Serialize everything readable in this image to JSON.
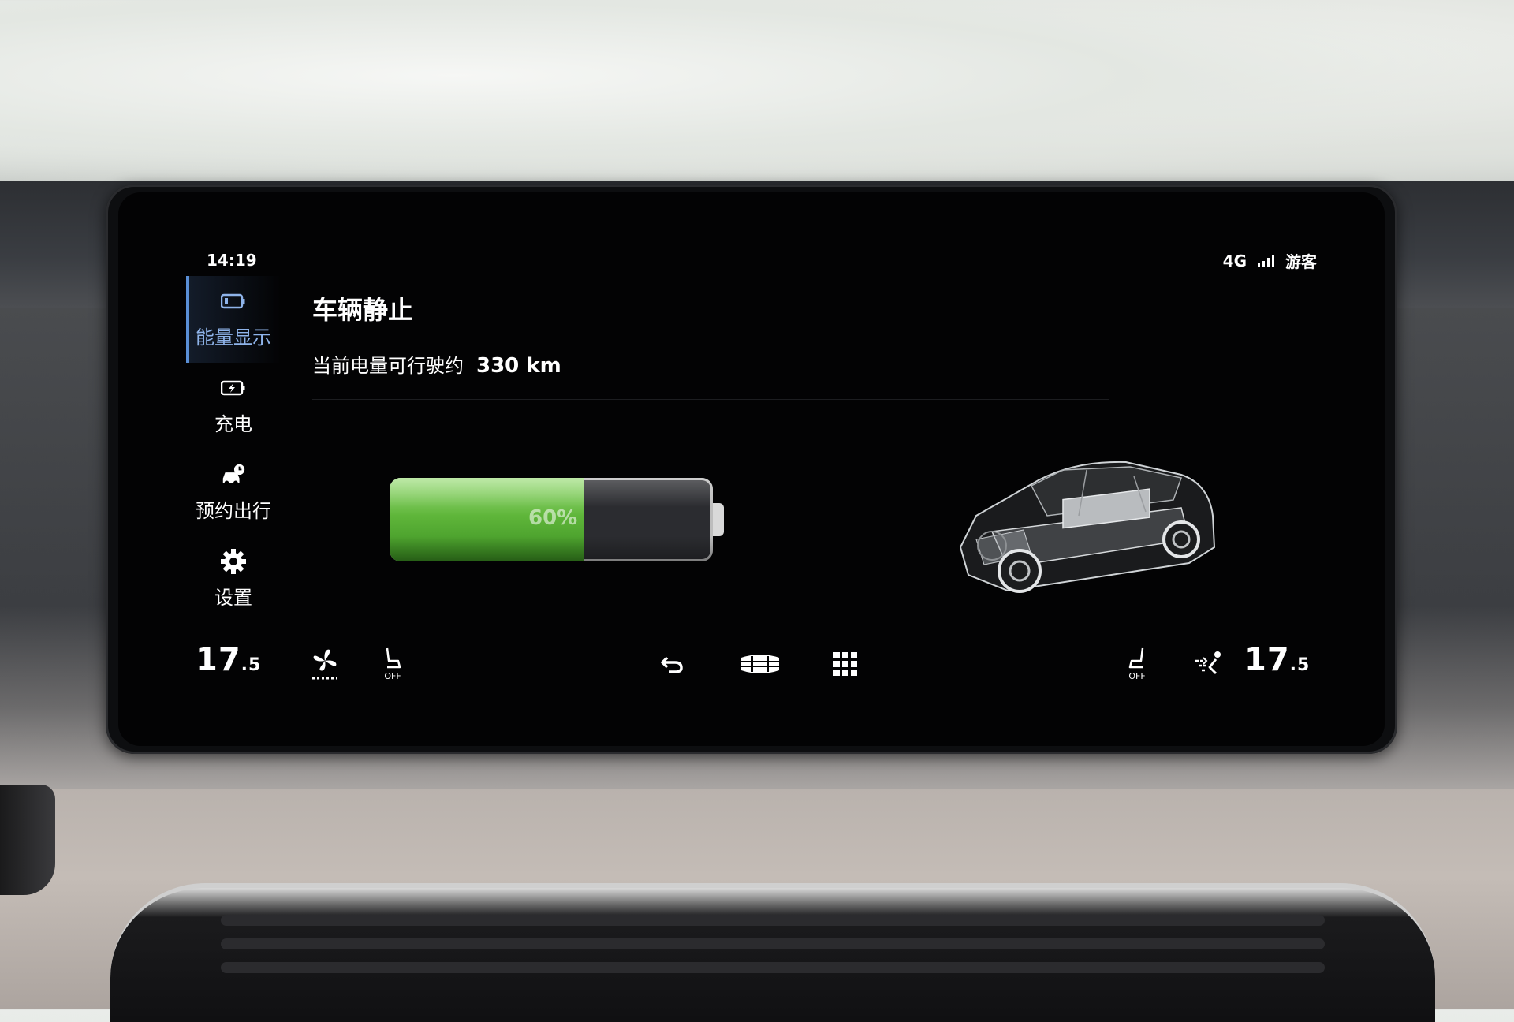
{
  "status": {
    "time": "14:19",
    "network": "4G",
    "user": "游客"
  },
  "sidebar": {
    "items": [
      {
        "label": "能量显示",
        "icon": "battery-icon",
        "active": true
      },
      {
        "label": "充电",
        "icon": "charging-icon",
        "active": false
      },
      {
        "label": "预约出行",
        "icon": "scheduled-trip-icon",
        "active": false
      },
      {
        "label": "设置",
        "icon": "gear-icon",
        "active": false
      }
    ]
  },
  "main": {
    "title": "车辆静止",
    "range_label": "当前电量可行驶约",
    "range_value": "330 km",
    "battery_percent_text": "60%",
    "battery_level": 0.6,
    "car_image": "chassis-xray-car-illustration"
  },
  "bottom_bar": {
    "left_temp": "17",
    "left_temp_decimal": "5",
    "right_temp": "17",
    "right_temp_decimal": "5",
    "left_seat_heat": "OFF",
    "right_seat_heat": "OFF",
    "icons": [
      "fan-icon",
      "seat-heat-icon",
      "back-icon",
      "brand-logo-icon",
      "app-grid-icon",
      "seat-heat-icon",
      "airflow-icon"
    ]
  },
  "colors": {
    "accent": "#5a8fd6",
    "battery_green": "#5fb63a",
    "background": "#030304"
  }
}
